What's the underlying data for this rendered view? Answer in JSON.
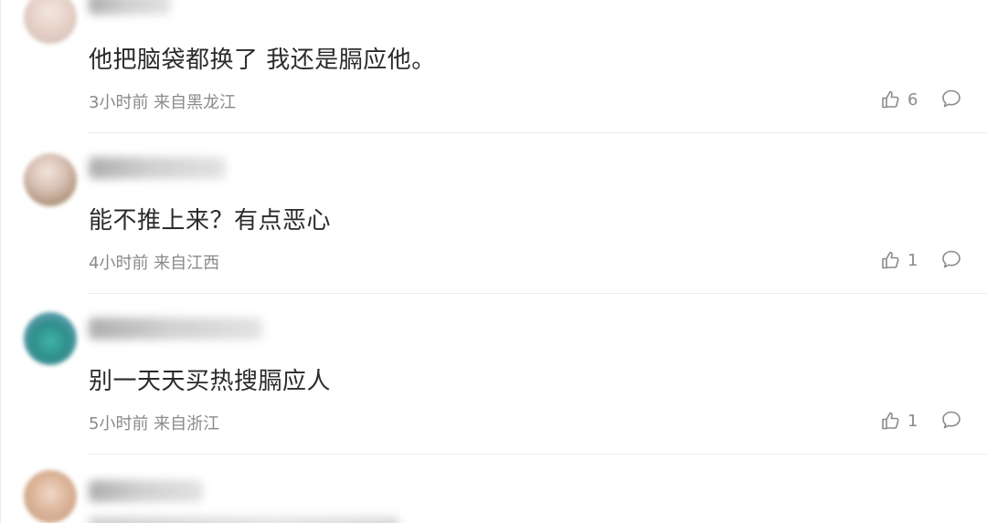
{
  "comments": [
    {
      "text": "他把脑袋都换了 我还是膈应他。",
      "meta": "3小时前 来自黑龙江",
      "likes": "6"
    },
    {
      "text": "能不推上来？有点恶心",
      "meta": "4小时前 来自江西",
      "likes": "1"
    },
    {
      "text": "别一天天买热搜膈应人",
      "meta": "5小时前 来自浙江",
      "likes": "1"
    }
  ],
  "icons": {
    "like": "thumbs-up-icon",
    "reply": "speech-bubble-icon"
  },
  "colors": {
    "text": "#2b2b2b",
    "meta": "#8a8a8a",
    "divider": "#ececec"
  }
}
